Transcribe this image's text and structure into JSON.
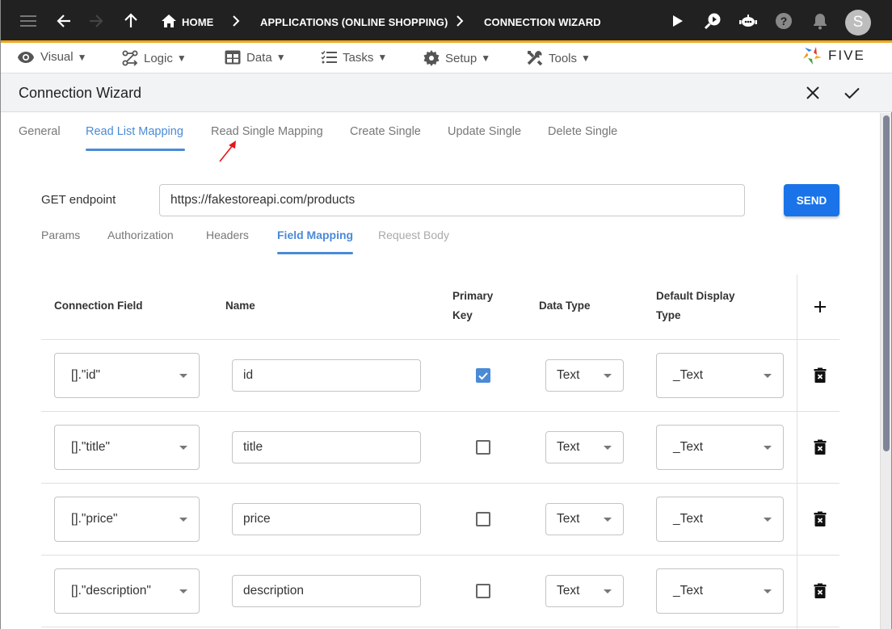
{
  "topbar": {
    "breadcrumbs": [
      "HOME",
      "APPLICATIONS (ONLINE SHOPPING)",
      "CONNECTION WIZARD"
    ],
    "avatar_initial": "S"
  },
  "menubar": {
    "items": [
      {
        "label": "Visual",
        "icon": "eye-icon"
      },
      {
        "label": "Logic",
        "icon": "logic-flow-icon"
      },
      {
        "label": "Data",
        "icon": "table-icon"
      },
      {
        "label": "Tasks",
        "icon": "checklist-icon"
      },
      {
        "label": "Setup",
        "icon": "gear-icon"
      },
      {
        "label": "Tools",
        "icon": "tools-icon"
      }
    ],
    "caret": "▼",
    "logo_text": "FIVE"
  },
  "header": {
    "title": "Connection Wizard"
  },
  "tabs": [
    {
      "label": "General",
      "active": false
    },
    {
      "label": "Read List Mapping",
      "active": true
    },
    {
      "label": "Read Single Mapping",
      "active": false
    },
    {
      "label": "Create Single",
      "active": false
    },
    {
      "label": "Update Single",
      "active": false
    },
    {
      "label": "Delete Single",
      "active": false
    }
  ],
  "endpoint": {
    "label": "GET endpoint",
    "value": "https://fakestoreapi.com/products",
    "send_label": "SEND"
  },
  "sub_tabs": [
    {
      "label": "Params",
      "state": "normal"
    },
    {
      "label": "Authorization",
      "state": "normal"
    },
    {
      "label": "Headers",
      "state": "normal"
    },
    {
      "label": "Field Mapping",
      "state": "active"
    },
    {
      "label": "Request Body",
      "state": "disabled"
    }
  ],
  "table": {
    "headers": {
      "connection_field": "Connection Field",
      "name": "Name",
      "primary_key_1": "Primary",
      "primary_key_2": "Key",
      "data_type": "Data Type",
      "default_display_1": "Default Display",
      "default_display_2": "Type"
    },
    "rows": [
      {
        "connection_field": "[].\"id\"",
        "name": "id",
        "primary_key": true,
        "data_type": "Text",
        "display_type": "_Text"
      },
      {
        "connection_field": "[].\"title\"",
        "name": "title",
        "primary_key": false,
        "data_type": "Text",
        "display_type": "_Text"
      },
      {
        "connection_field": "[].\"price\"",
        "name": "price",
        "primary_key": false,
        "data_type": "Text",
        "display_type": "_Text"
      },
      {
        "connection_field": "[].\"description\"",
        "name": "description",
        "primary_key": false,
        "data_type": "Text",
        "display_type": "_Text"
      }
    ]
  },
  "colors": {
    "accent": "#4a8ad6",
    "send_button": "#1a73e8",
    "topbar": "#212121",
    "topbar_border": "#f2a71b",
    "annotation_arrow": "#e8141a"
  }
}
